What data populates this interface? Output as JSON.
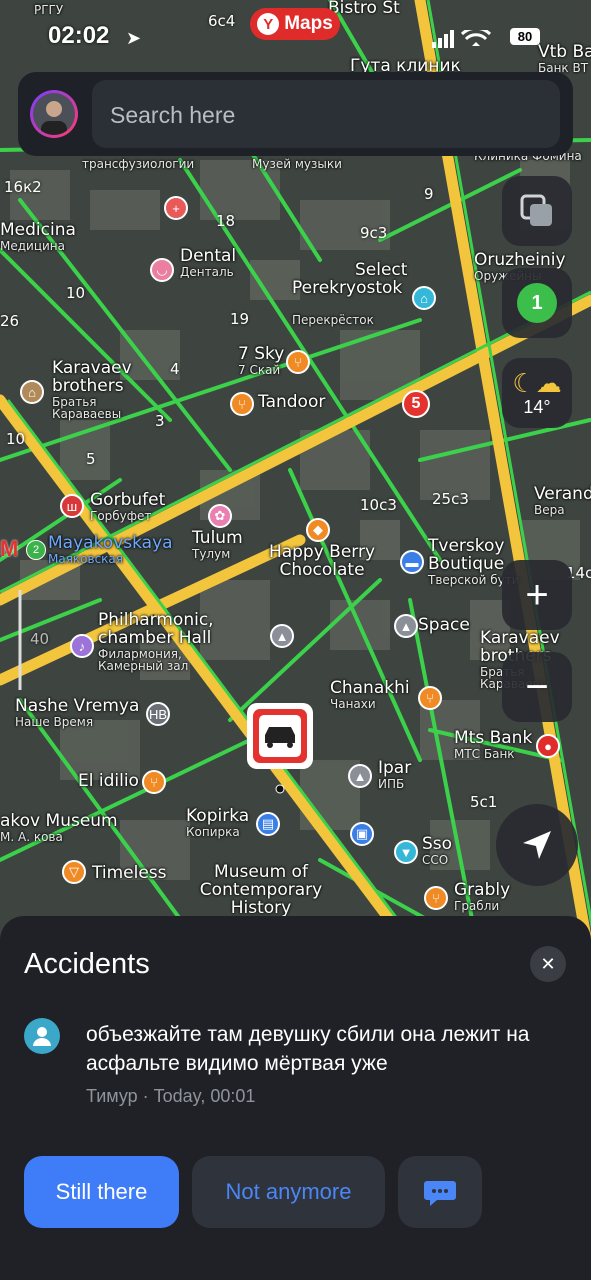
{
  "status_bar": {
    "time": "02:02",
    "battery": "80"
  },
  "app_badge": {
    "logo_letter": "Y",
    "label": "Maps"
  },
  "search": {
    "placeholder": "Search here"
  },
  "weather": {
    "temperature": "14°"
  },
  "traffic": {
    "level": "1"
  },
  "map": {
    "labels": [
      {
        "id": "medicina",
        "big": "Medicina",
        "small": "Медицина"
      },
      {
        "id": "dental",
        "big": "Dental",
        "small": "Денталь"
      },
      {
        "id": "perekryostok",
        "big": "Perekryostok",
        "small": "Перекрёсток"
      },
      {
        "id": "select",
        "big": "Select",
        "small": "Select"
      },
      {
        "id": "oruzheiniy",
        "big": "Oruzheiniy",
        "small": "Оружейны"
      },
      {
        "id": "seven-sky",
        "big": "7 Sky",
        "small": "7 Скай"
      },
      {
        "id": "karavaev-brothers",
        "big": "Karavaev brothers",
        "small": "Братья Караваевы"
      },
      {
        "id": "tandoor",
        "big": "Tandoor",
        "small": ""
      },
      {
        "id": "gorbufet",
        "big": "Gorbufet",
        "small": "Горбуфет"
      },
      {
        "id": "mayakovskaya",
        "big": "Mayakovskaya",
        "small": "Маяковская"
      },
      {
        "id": "tulum",
        "big": "Tulum",
        "small": "Тулум"
      },
      {
        "id": "happy-berry",
        "big": "Happy Berry Chocolate",
        "small": ""
      },
      {
        "id": "tverskoy-boutique",
        "big": "Tverskoy Boutique",
        "small": "Тверской бути"
      },
      {
        "id": "philharmonic",
        "big": "Philharmonic, chamber Hall",
        "small": "Филармония, Камерный зал"
      },
      {
        "id": "space",
        "big": "Space",
        "small": ""
      },
      {
        "id": "karavaev-brothers-2",
        "big": "Karavaev brothers",
        "small": "Братья Караваевы"
      },
      {
        "id": "nashe-vremya",
        "big": "Nashe Vremya",
        "small": "Наше Время"
      },
      {
        "id": "chanakhi",
        "big": "Chanakhi",
        "small": "Чанахи"
      },
      {
        "id": "mts-bank",
        "big": "Mts Bank",
        "small": "МТС Банк"
      },
      {
        "id": "el-idilio",
        "big": "El idilio",
        "small": ""
      },
      {
        "id": "ipar",
        "big": "Ipar",
        "small": "ИПБ"
      },
      {
        "id": "akov-museum",
        "big": "akov Museum",
        "small": "М. А. кова"
      },
      {
        "id": "kopirka",
        "big": "Kopirka",
        "small": "Копирка"
      },
      {
        "id": "sso",
        "big": "Sso",
        "small": "ССО"
      },
      {
        "id": "timeless",
        "big": "Timeless",
        "small": ""
      },
      {
        "id": "museum-contemporary",
        "big": "Museum of Contemporary History",
        "small": ""
      },
      {
        "id": "grably",
        "big": "Grably",
        "small": "Грабли"
      },
      {
        "id": "verand",
        "big": "Verand",
        "small": "Вера"
      },
      {
        "id": "muzey-muzyki",
        "big": "",
        "small": "Музей музыки"
      },
      {
        "id": "transfuziologii",
        "big": "",
        "small": "трансфузиологии"
      },
      {
        "id": "klinika-fomina",
        "big": "",
        "small": "Клиника Фомина"
      },
      {
        "id": "guta-klinik",
        "big": "Гута клиник",
        "small": ""
      },
      {
        "id": "vtb-bank",
        "big": "Vtb Ba",
        "small": "Банк ВТ"
      },
      {
        "id": "bistro",
        "big": "Bistro St",
        "small": ""
      },
      {
        "id": "rggu",
        "big": "",
        "small": "РГГУ"
      }
    ],
    "numbers": [
      "6с4",
      "16к2",
      "18",
      "9с3",
      "10",
      "19",
      "26",
      "4",
      "3",
      "10",
      "5",
      "9",
      "10с3",
      "25с3",
      "14с",
      "5с1",
      "40"
    ],
    "metro_badge": "2",
    "route_badge": "5",
    "hb_badge": "НВ"
  },
  "sheet": {
    "title": "Accidents",
    "comment": "объезжайте там девушку сбили она лежит на асфальте видимо мёртвая уже",
    "meta": "Тимур · Today, 00:01",
    "still_there": "Still there",
    "not_anymore": "Not anymore"
  },
  "colors": {
    "accent_blue": "#3f7cf7",
    "road_yellow": "#f2c53d",
    "road_green": "#3bd14a",
    "sheet_bg": "#1f2126"
  }
}
